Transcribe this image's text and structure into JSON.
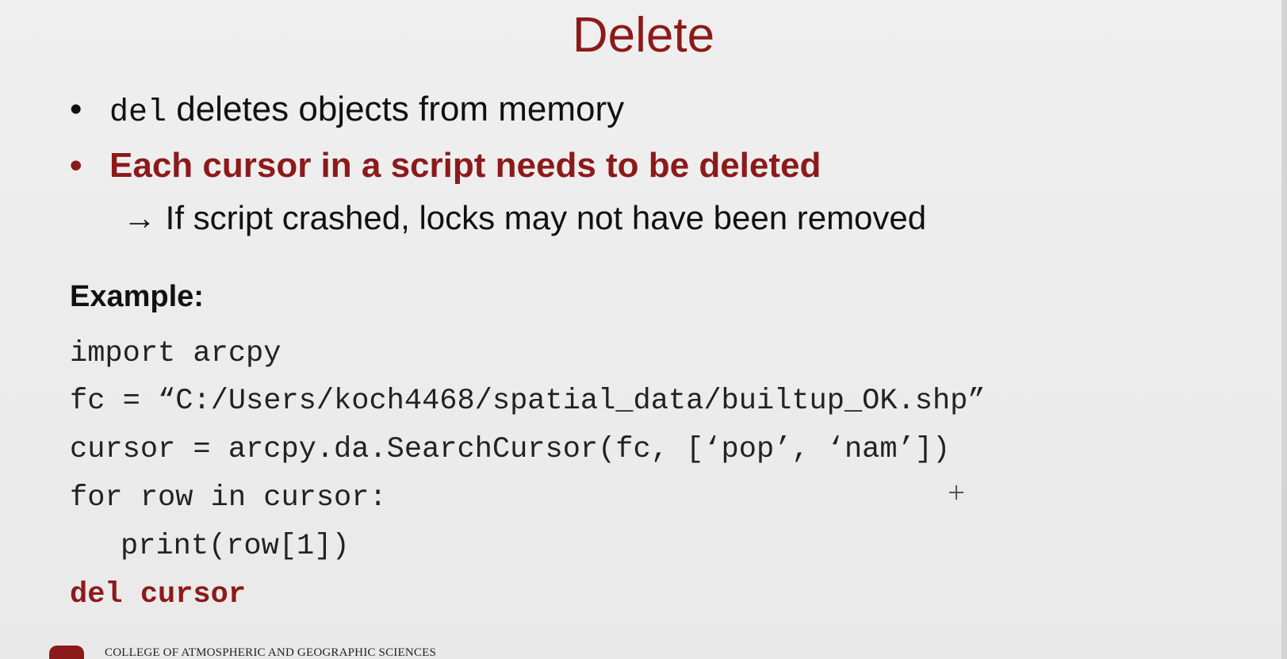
{
  "slide": {
    "title": "Delete",
    "bullets": [
      {
        "marker": "•",
        "code": "del",
        "text": " deletes objects from memory"
      },
      {
        "marker": "•",
        "text": "Each cursor in a script needs to be deleted",
        "color": "#8c1a1a"
      }
    ],
    "subbullet": "→ If script crashed, locks may not have been removed",
    "example_label": "Example:",
    "code_lines": [
      "import arcpy",
      "fc = “C:/Users/koch4468/spatial_data/builtup_OK.shp”",
      "cursor = arcpy.da.SearchCursor(fc, [‘pop’, ‘nam’])",
      "for row in cursor:",
      "print(row[1])",
      "del cursor"
    ],
    "footer": "COLLEGE OF ATMOSPHERIC AND GEOGRAPHIC SCIENCES"
  },
  "colors": {
    "accent": "#8c1a1a",
    "background": "#ececec",
    "text": "#111111"
  },
  "icons": {
    "cursor": "crosshair-icon",
    "logo": "university-logo"
  }
}
